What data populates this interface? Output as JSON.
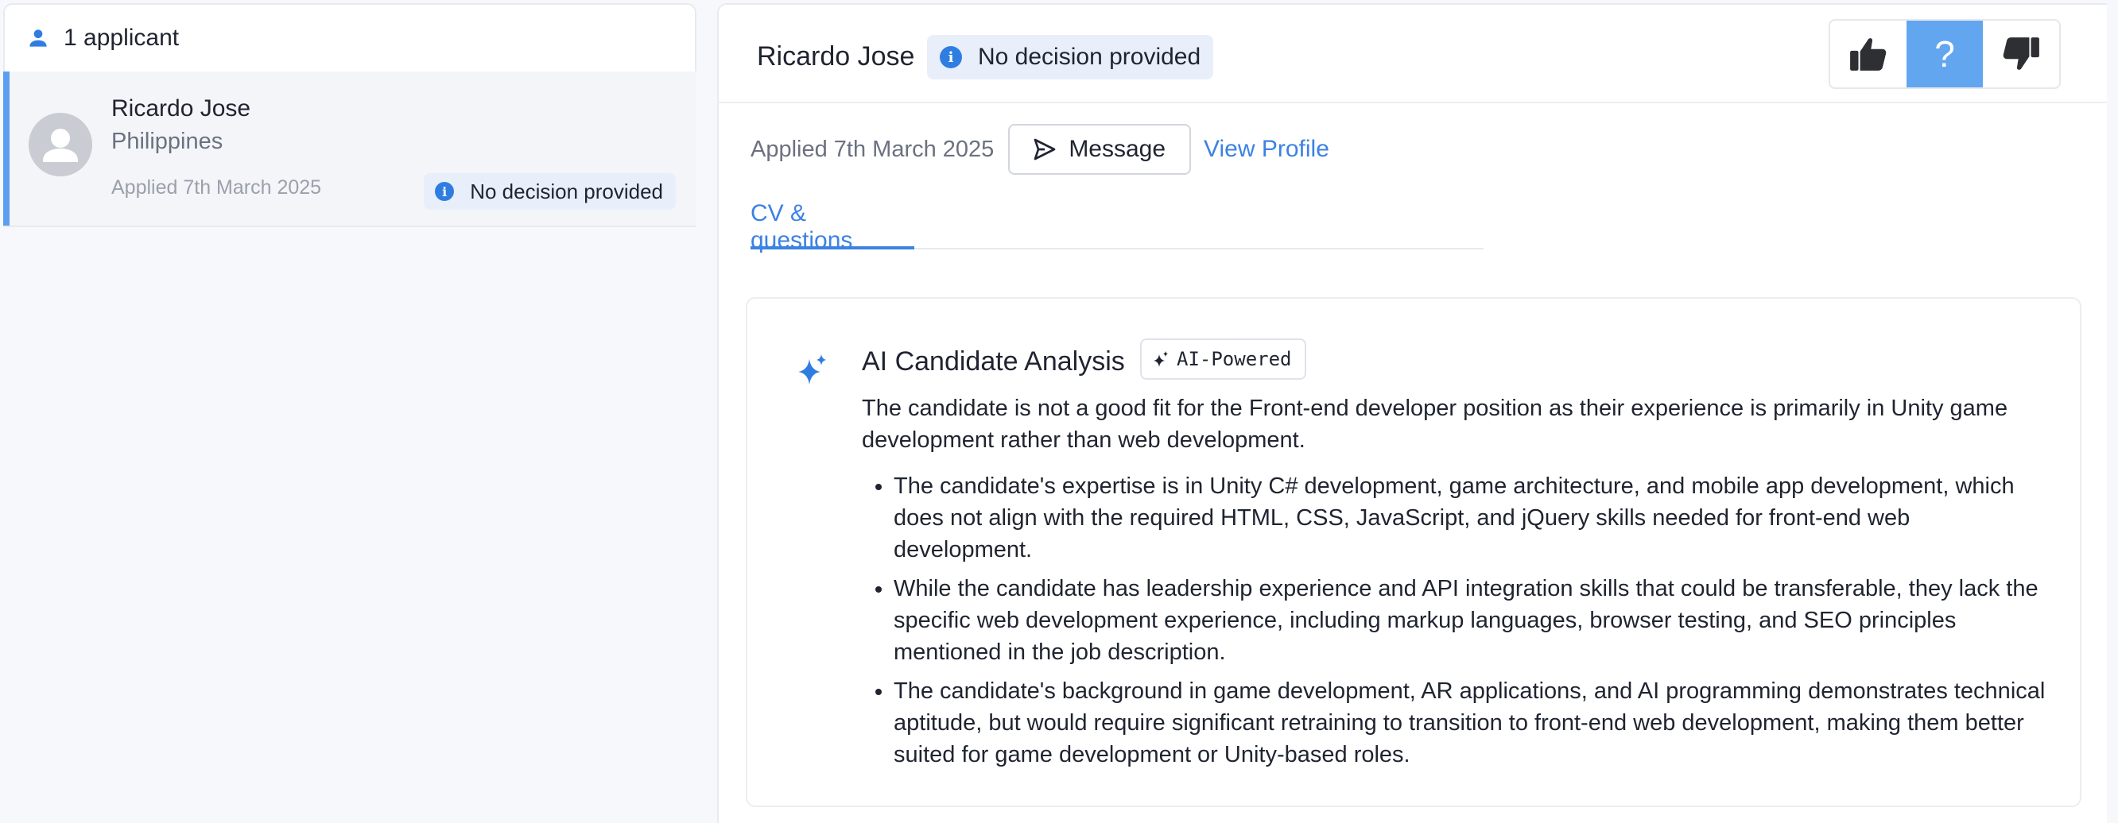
{
  "sidebar": {
    "applicant_count": "1 applicant",
    "applicants": [
      {
        "name": "Ricardo Jose",
        "country": "Philippines",
        "applied": "Applied 7th March 2025",
        "status": "No decision provided"
      }
    ]
  },
  "candidate": {
    "name": "Ricardo Jose",
    "status": "No decision provided",
    "applied": "Applied 7th March 2025",
    "message_label": "Message",
    "view_profile_label": "View Profile",
    "decision": {
      "maybe_label": "?",
      "selected": "maybe",
      "active_color": "#62a6f0"
    }
  },
  "tabs": [
    {
      "label": "CV & questions",
      "active": true
    }
  ],
  "analysis": {
    "title": "AI Candidate Analysis",
    "badge": "AI-Powered",
    "summary": "The candidate is not a good fit for the Front-end developer position as their experience is primarily in Unity game development rather than web development.",
    "points": [
      "The candidate's expertise is in Unity C# development, game architecture, and mobile app development, which does not align with the required HTML, CSS, JavaScript, and jQuery skills needed for front-end web development.",
      "While the candidate has leadership experience and API integration skills that could be transferable, they lack the specific web development experience, including markup languages, browser testing, and SEO principles mentioned in the job description.",
      "The candidate's background in game development, AR applications, and AI programming demonstrates technical aptitude, but would require significant retraining to transition to front-end web development, making them better suited for game development or Unity-based roles."
    ]
  },
  "colors": {
    "accent": "#3c82e3",
    "info_icon": "#2f7de1",
    "badge_bg": "#e8effa",
    "selected_bar": "#5d9ef0"
  }
}
